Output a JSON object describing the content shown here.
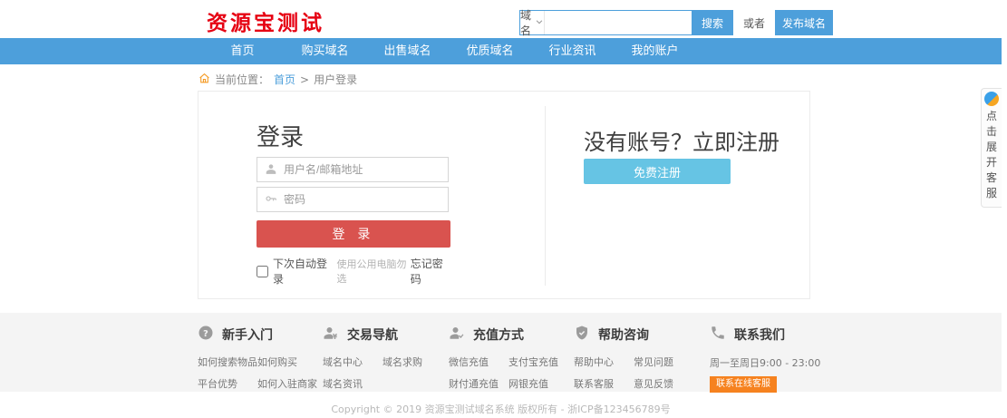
{
  "header": {
    "logo": "资源宝测试",
    "search": {
      "category_label": "域名",
      "input_value": "",
      "search_button": "搜索",
      "or_text": "或者",
      "publish_button": "发布域名"
    }
  },
  "nav": {
    "items": [
      "首页",
      "购买域名",
      "出售域名",
      "优质域名",
      "行业资讯",
      "我的账户"
    ]
  },
  "breadcrumb": {
    "label": "当前位置：",
    "home": "首页",
    "separator": ">",
    "current": "用户登录"
  },
  "login": {
    "title": "登录",
    "username_placeholder": "用户名/邮箱地址",
    "password_placeholder": "密码",
    "submit_label": "登 录",
    "remember_label": "下次自动登录",
    "remember_hint": "使用公用电脑勿选",
    "forgot_link": "忘记密码"
  },
  "register": {
    "title": "没有账号？立即注册",
    "button_label": "免费注册"
  },
  "footer": {
    "columns": [
      {
        "icon": "question-circle",
        "title": "新手入门",
        "links": [
          "如何搜索物品",
          "如何购买",
          "平台优势",
          "如何入驻商家"
        ]
      },
      {
        "icon": "user-yen",
        "title": "交易导航",
        "links": [
          "域名中心",
          "域名求购",
          "域名资讯",
          ""
        ]
      },
      {
        "icon": "user-recharge",
        "title": "充值方式",
        "links": [
          "微信充值",
          "支付宝充值",
          "财付通充值",
          "网银充值"
        ]
      },
      {
        "icon": "shield",
        "title": "帮助咨询",
        "links": [
          "帮助中心",
          "常见问题",
          "联系客服",
          "意见反馈"
        ]
      }
    ],
    "contact": {
      "icon": "phone",
      "title": "联系我们",
      "hours": "周一至周日9:00 - 23:00",
      "button_label": "联系在线客服"
    }
  },
  "copyright": "Copyright © 2019 资源宝测试域名系统 版权所有 - 浙ICP备123456789号",
  "service_widget": {
    "label": "点击展开客服"
  },
  "colors": {
    "nav_blue": "#4d9fdb",
    "logo_red": "#e60012",
    "login_red": "#d9534f",
    "register_blue": "#66c4e4",
    "contact_orange": "#f6821f",
    "footer_bg": "#f4f4f4"
  }
}
